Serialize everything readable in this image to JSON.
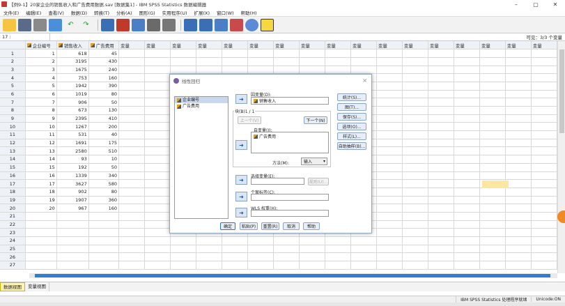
{
  "window": {
    "title": "【例9-1】20家企业的销售收入和广告费用数据.sav [数据集1] - IBM SPSS Statistics 数据编辑器",
    "min": "–",
    "max": "▢",
    "close": "✕"
  },
  "menu": [
    "文件(E)",
    "编辑(E)",
    "查看(V)",
    "数据(D)",
    "转换(T)",
    "分析(A)",
    "图形(G)",
    "实用程序(U)",
    "扩展(X)",
    "窗口(W)",
    "帮助(H)"
  ],
  "cellbar": {
    "ref": "17 :",
    "visible": "可见：3/3 个变量"
  },
  "grid": {
    "columns": [
      "企业编号",
      "销售收入",
      "广告费用",
      "变量",
      "变量",
      "变量",
      "变量",
      "变量",
      "变量",
      "变量",
      "变量",
      "变量",
      "变量",
      "变量",
      "变量",
      "变量",
      "变量",
      "变量",
      "变量",
      "变量"
    ],
    "rows": [
      [
        1,
        618,
        45
      ],
      [
        2,
        3195,
        430
      ],
      [
        3,
        1675,
        240
      ],
      [
        4,
        753,
        160
      ],
      [
        5,
        1942,
        390
      ],
      [
        6,
        1019,
        80
      ],
      [
        7,
        906,
        50
      ],
      [
        8,
        673,
        130
      ],
      [
        9,
        2395,
        410
      ],
      [
        10,
        1267,
        200
      ],
      [
        11,
        531,
        40
      ],
      [
        12,
        1691,
        175
      ],
      [
        13,
        2580,
        510
      ],
      [
        14,
        93,
        10
      ],
      [
        15,
        192,
        50
      ],
      [
        16,
        1339,
        340
      ],
      [
        17,
        3627,
        580
      ],
      [
        18,
        902,
        80
      ],
      [
        19,
        1907,
        360
      ],
      [
        20,
        967,
        160
      ]
    ],
    "total_rows": 27
  },
  "tabs": {
    "data_view": "数据视图",
    "variable_view": "变量视图"
  },
  "status": {
    "processor": "IBM SPSS Statistics 处理程序就绪",
    "unicode": "Unicode:ON"
  },
  "dialog": {
    "title": "线性回归",
    "close": "×",
    "source_vars": [
      "企业编号",
      "广告费用"
    ],
    "dependent_label": "因变量(D):",
    "dependent_value": "销售收入",
    "block_label": "块(B)1 / 1",
    "prev_btn": "上一个(V)",
    "next_btn": "下一个(N)",
    "independent_label": "自变量(I):",
    "independent_values": [
      "广告费用"
    ],
    "method_label": "方法(M):",
    "method_value": "输入",
    "selection_label": "选择变量(E):",
    "rule_btn": "规则(U)...",
    "case_label": "个案标签(C):",
    "wls_label": "WLS 权重(H):",
    "side_buttons": [
      "统计(S)...",
      "图(T)...",
      "保存(S)...",
      "选项(O)...",
      "样式(L)...",
      "自助抽样(B)..."
    ],
    "bottom_buttons": [
      "确定",
      "粘贴(P)",
      "重置(R)",
      "取消",
      "帮助"
    ]
  }
}
